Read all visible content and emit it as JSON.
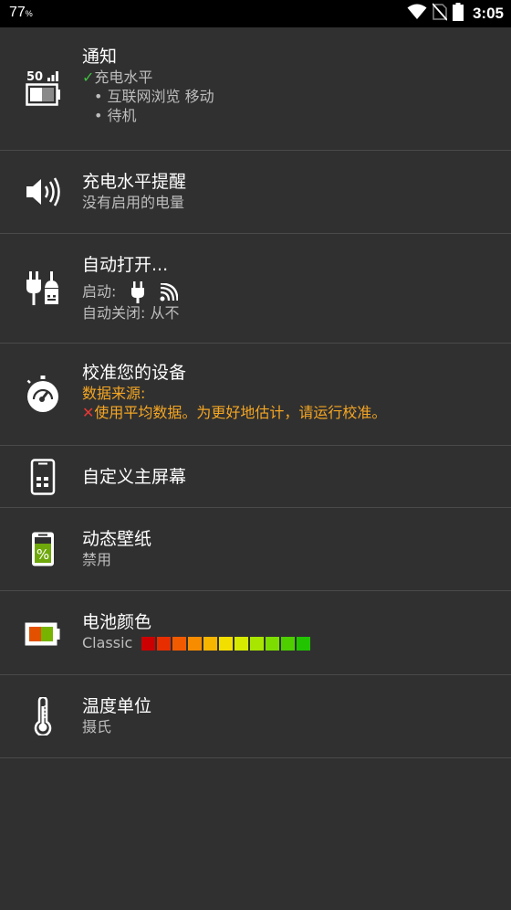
{
  "status_bar": {
    "battery_percent": "77",
    "percent_sign": "%",
    "time": "3:05",
    "icons": [
      "wifi-icon",
      "no-sim-icon",
      "battery-icon"
    ]
  },
  "settings": {
    "notification": {
      "title": "通知",
      "check_mark": "✓",
      "line1": "充电水平",
      "bullet1": "• 互联网浏览 移动",
      "bullet2": "• 待机",
      "icon_label": "50",
      "icon": "battery-level-icon"
    },
    "charge_alert": {
      "title": "充电水平提醒",
      "subtitle": "没有启用的电量",
      "icon": "speaker-icon"
    },
    "auto_on": {
      "title": "自动打开...",
      "start_label": "启动:",
      "off_label": "自动关闭: 从不",
      "icon": "plugs-icon"
    },
    "calibrate": {
      "title": "校准您的设备",
      "source_label": "数据来源:",
      "cross_mark": "✕",
      "warning": "使用平均数据。为更好地估计，请运行校准。",
      "icon": "stopwatch-icon"
    },
    "home_screen": {
      "title": "自定义主屏幕",
      "icon": "phone-widget-icon"
    },
    "live_wallpaper": {
      "title": "动态壁纸",
      "subtitle": "禁用",
      "icon_label": "%",
      "icon": "phone-percent-icon"
    },
    "battery_color": {
      "title": "电池颜色",
      "subtitle": "Classic",
      "icon": "color-battery-icon",
      "swatches": [
        "#cc0000",
        "#e62e00",
        "#f25a00",
        "#f78c00",
        "#f7b500",
        "#f2df00",
        "#d5ea00",
        "#a8e600",
        "#7ddd00",
        "#4fcf00",
        "#22c400"
      ]
    },
    "temperature": {
      "title": "温度单位",
      "subtitle": "摄氏",
      "icon": "thermometer-icon"
    }
  }
}
